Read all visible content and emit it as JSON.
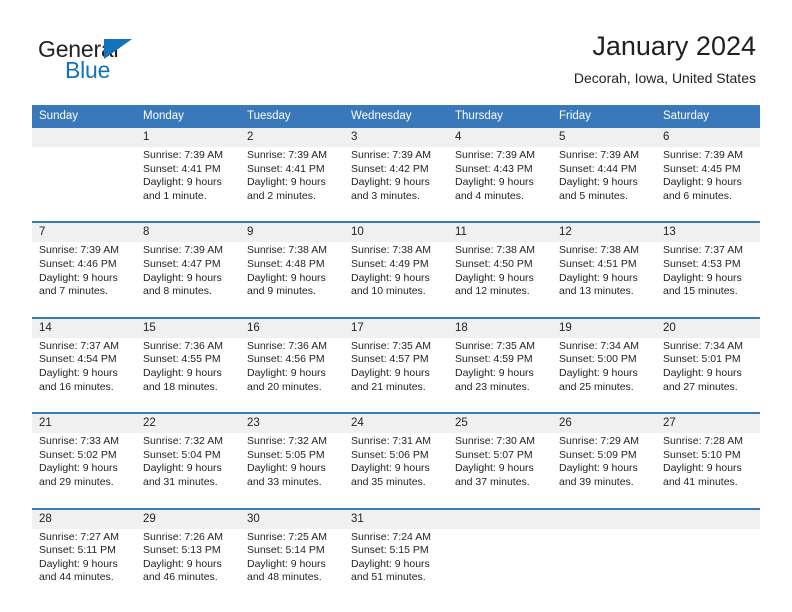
{
  "brand": {
    "name_part1": "General",
    "name_part2": "Blue",
    "triangle_color": "#1273b9",
    "text_color": "#231f20"
  },
  "header": {
    "month_title": "January 2024",
    "location": "Decorah, Iowa, United States",
    "header_bg": "#3a78bc",
    "header_text_color": "#ffffff",
    "daynum_bg": "#f0f0f0"
  },
  "weekday_headers": [
    "Sunday",
    "Monday",
    "Tuesday",
    "Wednesday",
    "Thursday",
    "Friday",
    "Saturday"
  ],
  "weeks": [
    {
      "days": [
        {
          "num": "",
          "sunrise": "",
          "sunset": "",
          "daylight1": "",
          "daylight2": ""
        },
        {
          "num": "1",
          "sunrise": "Sunrise: 7:39 AM",
          "sunset": "Sunset: 4:41 PM",
          "daylight1": "Daylight: 9 hours",
          "daylight2": "and 1 minute."
        },
        {
          "num": "2",
          "sunrise": "Sunrise: 7:39 AM",
          "sunset": "Sunset: 4:41 PM",
          "daylight1": "Daylight: 9 hours",
          "daylight2": "and 2 minutes."
        },
        {
          "num": "3",
          "sunrise": "Sunrise: 7:39 AM",
          "sunset": "Sunset: 4:42 PM",
          "daylight1": "Daylight: 9 hours",
          "daylight2": "and 3 minutes."
        },
        {
          "num": "4",
          "sunrise": "Sunrise: 7:39 AM",
          "sunset": "Sunset: 4:43 PM",
          "daylight1": "Daylight: 9 hours",
          "daylight2": "and 4 minutes."
        },
        {
          "num": "5",
          "sunrise": "Sunrise: 7:39 AM",
          "sunset": "Sunset: 4:44 PM",
          "daylight1": "Daylight: 9 hours",
          "daylight2": "and 5 minutes."
        },
        {
          "num": "6",
          "sunrise": "Sunrise: 7:39 AM",
          "sunset": "Sunset: 4:45 PM",
          "daylight1": "Daylight: 9 hours",
          "daylight2": "and 6 minutes."
        }
      ]
    },
    {
      "days": [
        {
          "num": "7",
          "sunrise": "Sunrise: 7:39 AM",
          "sunset": "Sunset: 4:46 PM",
          "daylight1": "Daylight: 9 hours",
          "daylight2": "and 7 minutes."
        },
        {
          "num": "8",
          "sunrise": "Sunrise: 7:39 AM",
          "sunset": "Sunset: 4:47 PM",
          "daylight1": "Daylight: 9 hours",
          "daylight2": "and 8 minutes."
        },
        {
          "num": "9",
          "sunrise": "Sunrise: 7:38 AM",
          "sunset": "Sunset: 4:48 PM",
          "daylight1": "Daylight: 9 hours",
          "daylight2": "and 9 minutes."
        },
        {
          "num": "10",
          "sunrise": "Sunrise: 7:38 AM",
          "sunset": "Sunset: 4:49 PM",
          "daylight1": "Daylight: 9 hours",
          "daylight2": "and 10 minutes."
        },
        {
          "num": "11",
          "sunrise": "Sunrise: 7:38 AM",
          "sunset": "Sunset: 4:50 PM",
          "daylight1": "Daylight: 9 hours",
          "daylight2": "and 12 minutes."
        },
        {
          "num": "12",
          "sunrise": "Sunrise: 7:38 AM",
          "sunset": "Sunset: 4:51 PM",
          "daylight1": "Daylight: 9 hours",
          "daylight2": "and 13 minutes."
        },
        {
          "num": "13",
          "sunrise": "Sunrise: 7:37 AM",
          "sunset": "Sunset: 4:53 PM",
          "daylight1": "Daylight: 9 hours",
          "daylight2": "and 15 minutes."
        }
      ]
    },
    {
      "days": [
        {
          "num": "14",
          "sunrise": "Sunrise: 7:37 AM",
          "sunset": "Sunset: 4:54 PM",
          "daylight1": "Daylight: 9 hours",
          "daylight2": "and 16 minutes."
        },
        {
          "num": "15",
          "sunrise": "Sunrise: 7:36 AM",
          "sunset": "Sunset: 4:55 PM",
          "daylight1": "Daylight: 9 hours",
          "daylight2": "and 18 minutes."
        },
        {
          "num": "16",
          "sunrise": "Sunrise: 7:36 AM",
          "sunset": "Sunset: 4:56 PM",
          "daylight1": "Daylight: 9 hours",
          "daylight2": "and 20 minutes."
        },
        {
          "num": "17",
          "sunrise": "Sunrise: 7:35 AM",
          "sunset": "Sunset: 4:57 PM",
          "daylight1": "Daylight: 9 hours",
          "daylight2": "and 21 minutes."
        },
        {
          "num": "18",
          "sunrise": "Sunrise: 7:35 AM",
          "sunset": "Sunset: 4:59 PM",
          "daylight1": "Daylight: 9 hours",
          "daylight2": "and 23 minutes."
        },
        {
          "num": "19",
          "sunrise": "Sunrise: 7:34 AM",
          "sunset": "Sunset: 5:00 PM",
          "daylight1": "Daylight: 9 hours",
          "daylight2": "and 25 minutes."
        },
        {
          "num": "20",
          "sunrise": "Sunrise: 7:34 AM",
          "sunset": "Sunset: 5:01 PM",
          "daylight1": "Daylight: 9 hours",
          "daylight2": "and 27 minutes."
        }
      ]
    },
    {
      "days": [
        {
          "num": "21",
          "sunrise": "Sunrise: 7:33 AM",
          "sunset": "Sunset: 5:02 PM",
          "daylight1": "Daylight: 9 hours",
          "daylight2": "and 29 minutes."
        },
        {
          "num": "22",
          "sunrise": "Sunrise: 7:32 AM",
          "sunset": "Sunset: 5:04 PM",
          "daylight1": "Daylight: 9 hours",
          "daylight2": "and 31 minutes."
        },
        {
          "num": "23",
          "sunrise": "Sunrise: 7:32 AM",
          "sunset": "Sunset: 5:05 PM",
          "daylight1": "Daylight: 9 hours",
          "daylight2": "and 33 minutes."
        },
        {
          "num": "24",
          "sunrise": "Sunrise: 7:31 AM",
          "sunset": "Sunset: 5:06 PM",
          "daylight1": "Daylight: 9 hours",
          "daylight2": "and 35 minutes."
        },
        {
          "num": "25",
          "sunrise": "Sunrise: 7:30 AM",
          "sunset": "Sunset: 5:07 PM",
          "daylight1": "Daylight: 9 hours",
          "daylight2": "and 37 minutes."
        },
        {
          "num": "26",
          "sunrise": "Sunrise: 7:29 AM",
          "sunset": "Sunset: 5:09 PM",
          "daylight1": "Daylight: 9 hours",
          "daylight2": "and 39 minutes."
        },
        {
          "num": "27",
          "sunrise": "Sunrise: 7:28 AM",
          "sunset": "Sunset: 5:10 PM",
          "daylight1": "Daylight: 9 hours",
          "daylight2": "and 41 minutes."
        }
      ]
    },
    {
      "days": [
        {
          "num": "28",
          "sunrise": "Sunrise: 7:27 AM",
          "sunset": "Sunset: 5:11 PM",
          "daylight1": "Daylight: 9 hours",
          "daylight2": "and 44 minutes."
        },
        {
          "num": "29",
          "sunrise": "Sunrise: 7:26 AM",
          "sunset": "Sunset: 5:13 PM",
          "daylight1": "Daylight: 9 hours",
          "daylight2": "and 46 minutes."
        },
        {
          "num": "30",
          "sunrise": "Sunrise: 7:25 AM",
          "sunset": "Sunset: 5:14 PM",
          "daylight1": "Daylight: 9 hours",
          "daylight2": "and 48 minutes."
        },
        {
          "num": "31",
          "sunrise": "Sunrise: 7:24 AM",
          "sunset": "Sunset: 5:15 PM",
          "daylight1": "Daylight: 9 hours",
          "daylight2": "and 51 minutes."
        },
        {
          "num": "",
          "sunrise": "",
          "sunset": "",
          "daylight1": "",
          "daylight2": ""
        },
        {
          "num": "",
          "sunrise": "",
          "sunset": "",
          "daylight1": "",
          "daylight2": ""
        },
        {
          "num": "",
          "sunrise": "",
          "sunset": "",
          "daylight1": "",
          "daylight2": ""
        }
      ]
    }
  ]
}
